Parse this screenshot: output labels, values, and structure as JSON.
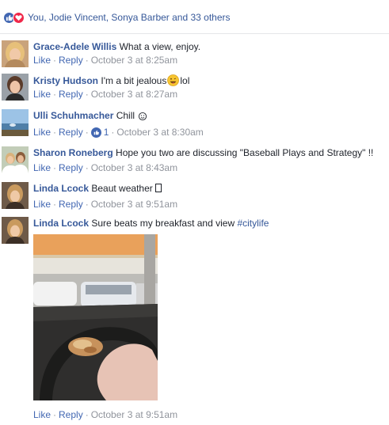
{
  "reactions": {
    "summary": "You, Jodie Vincent, Sonya Barber and 33 others",
    "like_icon": "thumbs-up-icon",
    "love_icon": "heart-icon",
    "colors": {
      "like": "#4267b2",
      "love": "#f0284a"
    }
  },
  "colors": {
    "link": "#365899",
    "action": "#4267b2",
    "meta": "#90949c",
    "text": "#1d2129"
  },
  "comments": [
    {
      "author": "Grace-Adele Willis",
      "text": "What a view, enjoy.",
      "like": "Like",
      "reply": "Reply",
      "time": "October 3 at 8:25am"
    },
    {
      "author": "Kristy Hudson",
      "text": "I'm a bit jealous",
      "text_after": "lol",
      "emoji": "grinning-tongue-emoji",
      "like": "Like",
      "reply": "Reply",
      "time": "October 3 at 8:27am"
    },
    {
      "author": "Ulli Schuhmacher",
      "text": "Chill",
      "emoji": "smiley-emoticon",
      "like": "Like",
      "reply": "Reply",
      "likes": "1",
      "time": "October 3 at 8:30am"
    },
    {
      "author": "Sharon Roneberg",
      "text": "Hope you two are discussing \"Baseball Plays and Strategy\" !!",
      "like": "Like",
      "reply": "Reply",
      "time": "October 3 at 8:43am"
    },
    {
      "author": "Linda Lcock",
      "text": "Beaut weather",
      "like": "Like",
      "reply": "Reply",
      "time": "October 3 at 9:51am"
    },
    {
      "author": "Linda Lcock",
      "text": "Sure beats my breakfast and view",
      "hashtag": "#citylife",
      "like": "Like",
      "reply": "Reply",
      "time": "October 3 at 9:51am"
    }
  ]
}
